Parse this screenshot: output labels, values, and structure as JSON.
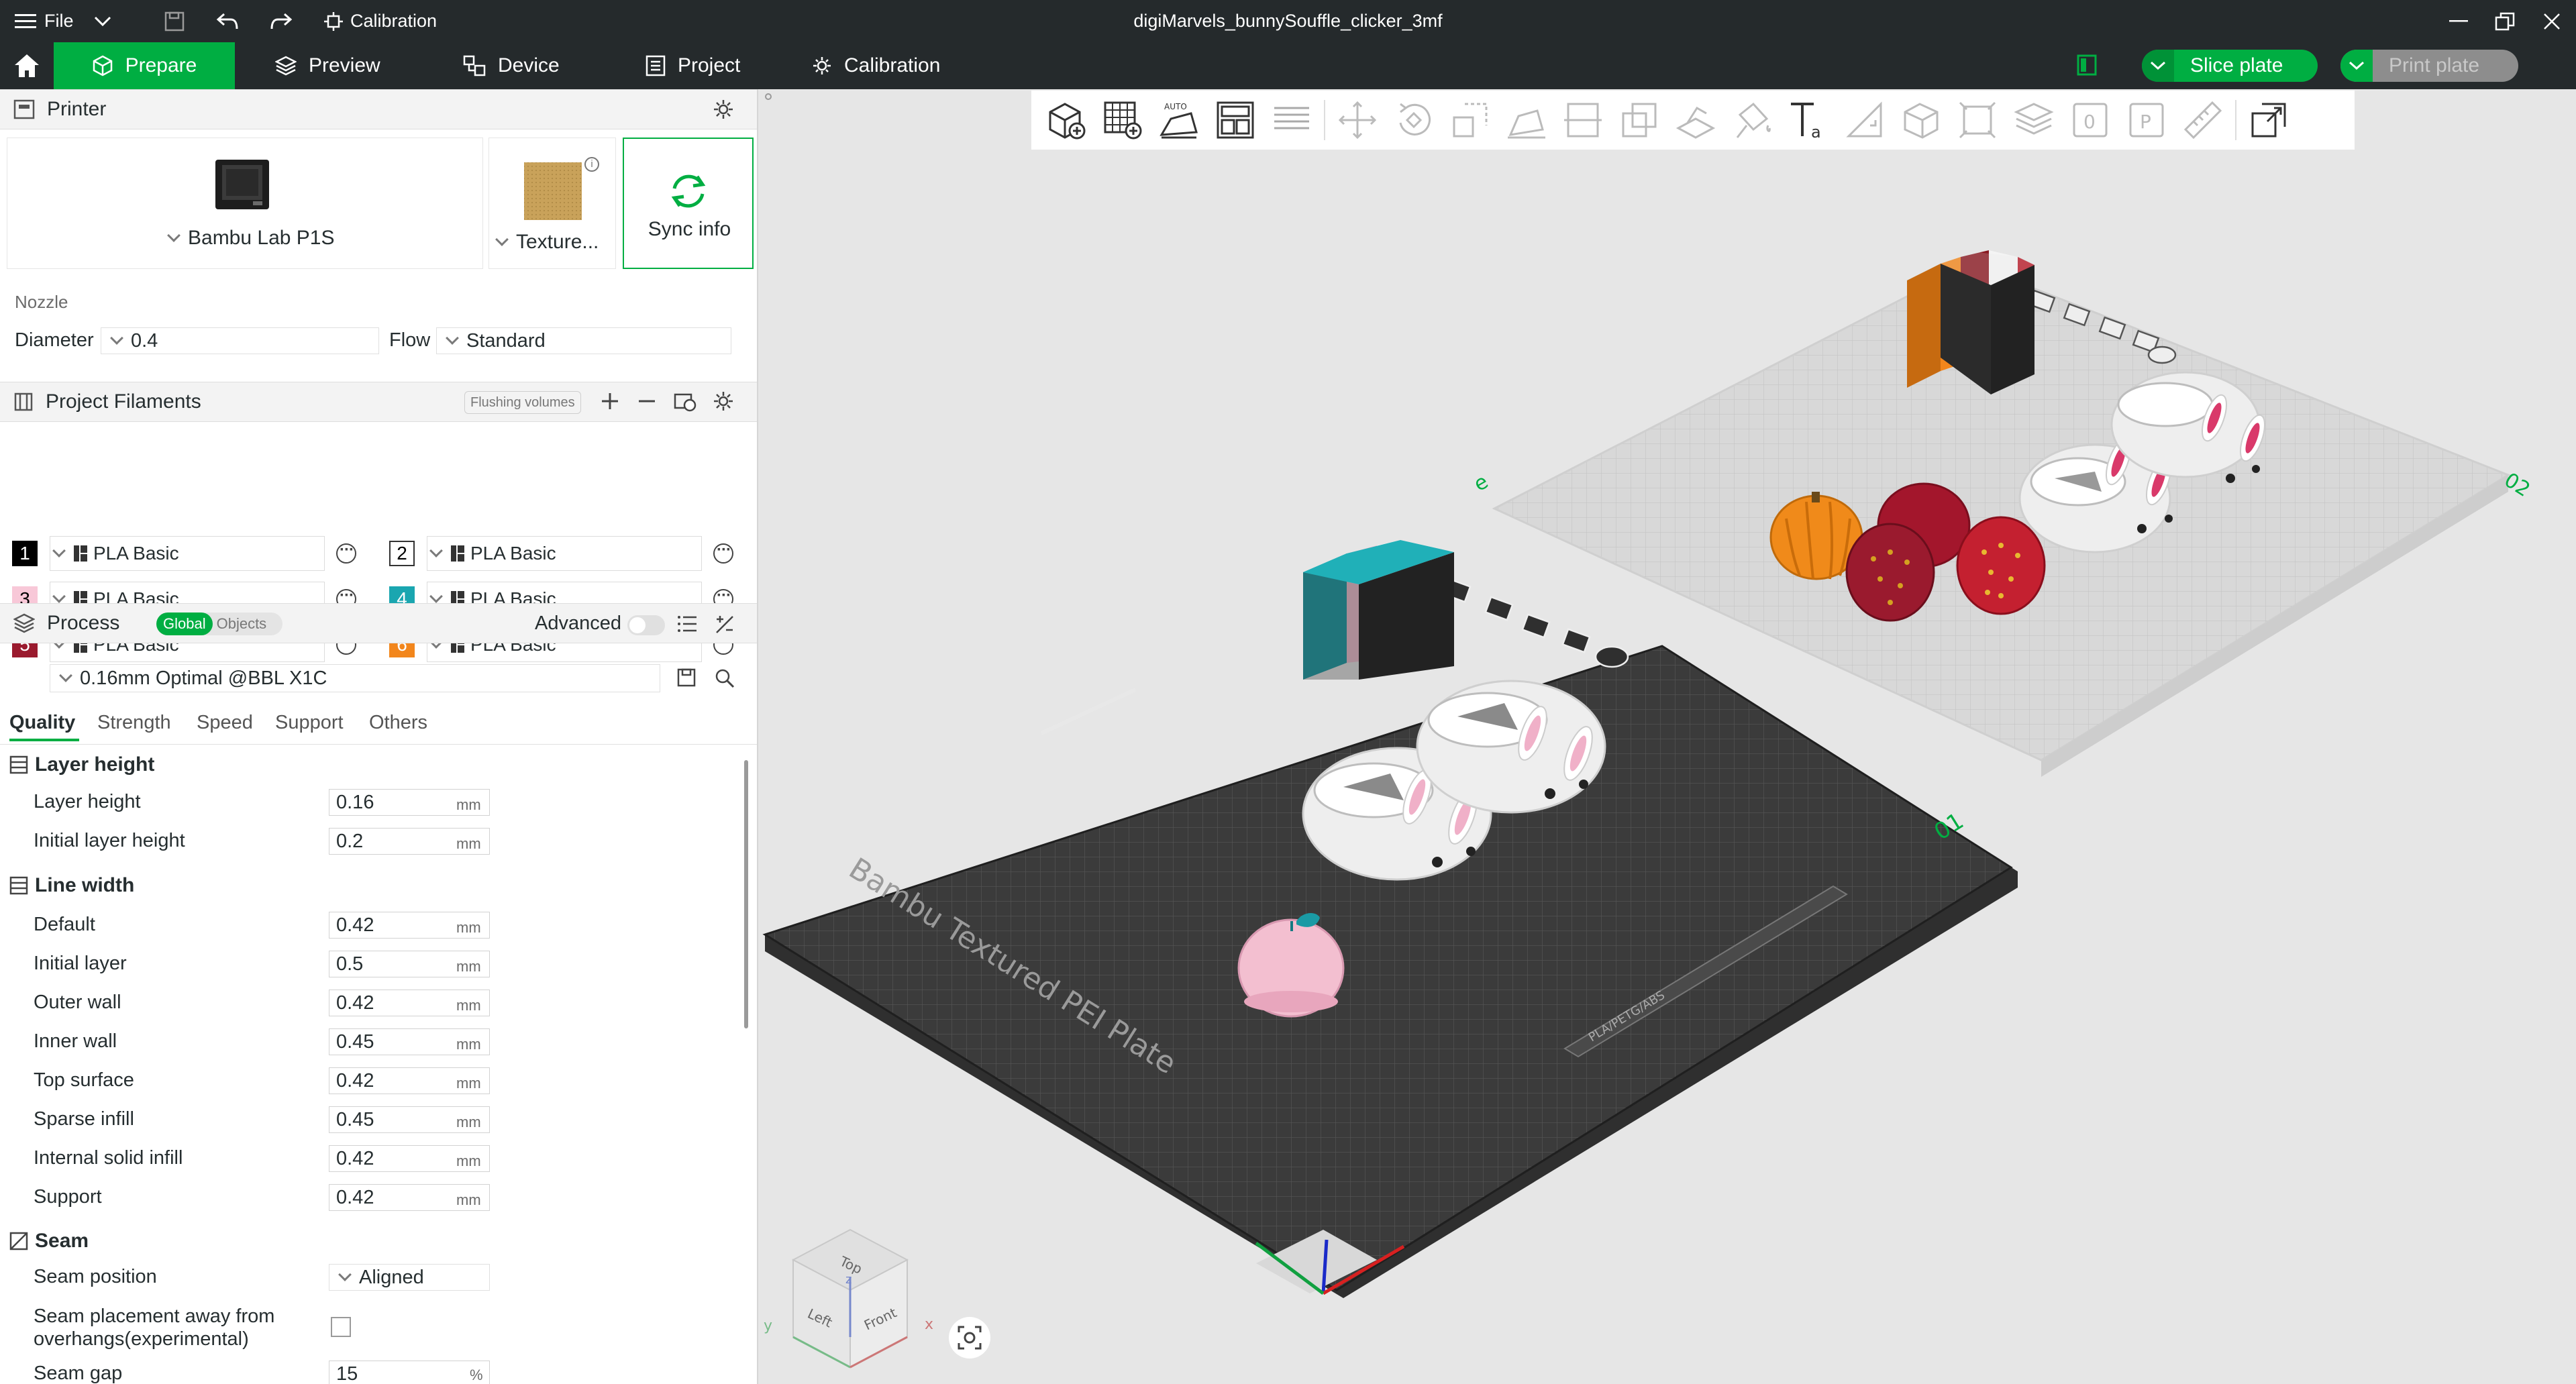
{
  "titlebar": {
    "file_label": "File",
    "calibration_label": "Calibration",
    "document_title": "digiMarvels_bunnySouffle_clicker_3mf"
  },
  "nav": {
    "tabs": [
      {
        "label": "Prepare"
      },
      {
        "label": "Preview"
      },
      {
        "label": "Device"
      },
      {
        "label": "Project"
      },
      {
        "label": "Calibration"
      }
    ],
    "slice_label": "Slice plate",
    "print_label": "Print plate"
  },
  "printer": {
    "section_title": "Printer",
    "printer_name": "Bambu Lab P1S",
    "plate_name": "Texture...",
    "sync_label": "Sync info",
    "nozzle_label": "Nozzle",
    "diameter_label": "Diameter",
    "diameter_value": "0.4",
    "flow_label": "Flow",
    "flow_value": "Standard"
  },
  "filaments": {
    "section_title": "Project Filaments",
    "flushing_label": "Flushing volumes",
    "items": [
      {
        "num": "1",
        "name": "PLA Basic",
        "color": "#000000",
        "text_color": "#ffffff"
      },
      {
        "num": "2",
        "name": "PLA Basic",
        "color": "#ffffff",
        "text_color": "#000000"
      },
      {
        "num": "3",
        "name": "PLA Basic",
        "color": "#f8c8d8",
        "text_color": "#000000"
      },
      {
        "num": "4",
        "name": "PLA Basic",
        "color": "#1aa6b0",
        "text_color": "#ffffff"
      },
      {
        "num": "5",
        "name": "PLA Basic",
        "color": "#9a1a2e",
        "text_color": "#ffffff"
      },
      {
        "num": "6",
        "name": "PLA Basic",
        "color": "#f2861c",
        "text_color": "#ffffff"
      }
    ]
  },
  "process": {
    "section_title": "Process",
    "global_label": "Global",
    "objects_label": "Objects",
    "advanced_label": "Advanced",
    "profile": "0.16mm Optimal @BBL X1C",
    "tabs": [
      "Quality",
      "Strength",
      "Speed",
      "Support",
      "Others"
    ],
    "layer_height_group": "Layer height",
    "layer_height_label": "Layer height",
    "layer_height_value": "0.16",
    "initial_layer_height_label": "Initial layer height",
    "initial_layer_height_value": "0.2",
    "line_width_group": "Line width",
    "line_widths": [
      {
        "label": "Default",
        "value": "0.42"
      },
      {
        "label": "Initial layer",
        "value": "0.5"
      },
      {
        "label": "Outer wall",
        "value": "0.42"
      },
      {
        "label": "Inner wall",
        "value": "0.45"
      },
      {
        "label": "Top surface",
        "value": "0.42"
      },
      {
        "label": "Sparse infill",
        "value": "0.45"
      },
      {
        "label": "Internal solid infill",
        "value": "0.42"
      },
      {
        "label": "Support",
        "value": "0.42"
      }
    ],
    "unit_mm": "mm",
    "seam_group": "Seam",
    "seam_position_label": "Seam position",
    "seam_position_value": "Aligned",
    "seam_away_label_1": "Seam placement away from",
    "seam_away_label_2": "overhangs(experimental)",
    "seam_gap_label": "Seam gap",
    "seam_gap_value": "15",
    "unit_percent": "%"
  },
  "viewport": {
    "plate1_text": "Bambu Textured PEI Plate",
    "plate1_number": "01",
    "plate2_number": "02",
    "plate_strip_text": "PLA/PETG/ABS",
    "cube_top": "Top",
    "cube_left": "Left",
    "cube_front": "Front",
    "axis_x": "x",
    "axis_y": "y",
    "axis_z": "z"
  },
  "colors": {
    "accent": "#00ae42",
    "titlebar": "#252a2c",
    "plate_dark": "#3a3a3a",
    "plate_light": "#d4d4d4"
  }
}
